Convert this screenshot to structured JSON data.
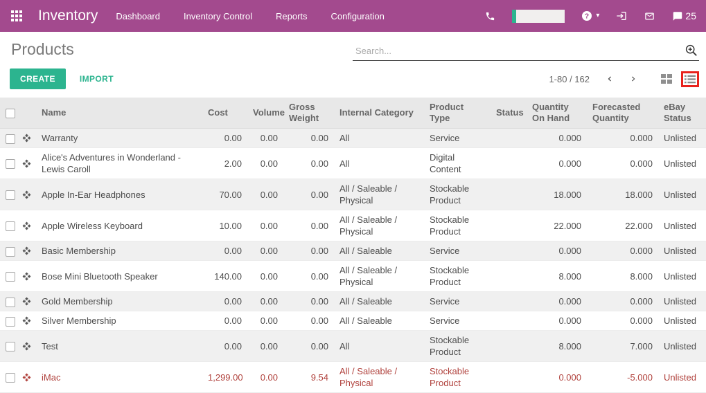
{
  "navbar": {
    "brand": "Inventory",
    "menu_items": [
      "Dashboard",
      "Inventory Control",
      "Reports",
      "Configuration"
    ],
    "message_count": "25",
    "icons": [
      "apps-grid-icon",
      "phone-icon",
      "planner-progress-bar",
      "help-circle-icon",
      "sign-in-icon",
      "envelope-icon",
      "chat-bubble-icon"
    ]
  },
  "control_panel": {
    "title": "Products",
    "search_placeholder": "Search...",
    "create_label": "CREATE",
    "import_label": "IMPORT",
    "pager_text": "1-80 / 162"
  },
  "table": {
    "columns": [
      {
        "label": "Name",
        "align": "left"
      },
      {
        "label": "Cost",
        "align": "right"
      },
      {
        "label": "Volume",
        "align": "right"
      },
      {
        "label": "Gross Weight",
        "align": "right"
      },
      {
        "label": "Internal Category",
        "align": "left"
      },
      {
        "label": "Product Type",
        "align": "left"
      },
      {
        "label": "Status",
        "align": "left"
      },
      {
        "label": "Quantity On Hand",
        "align": "right"
      },
      {
        "label": "Forecasted Quantity",
        "align": "right"
      },
      {
        "label": "eBay Status",
        "align": "left"
      }
    ],
    "rows": [
      {
        "cells": [
          "Warranty",
          "0.00",
          "0.00",
          "0.00",
          "All",
          "Service",
          "",
          "0.000",
          "0.000",
          "Unlisted"
        ],
        "alert": false
      },
      {
        "cells": [
          "Alice's Adventures in Wonderland - Lewis Caroll",
          "2.00",
          "0.00",
          "0.00",
          "All",
          "Digital Content",
          "",
          "0.000",
          "0.000",
          "Unlisted"
        ],
        "alert": false
      },
      {
        "cells": [
          "Apple In-Ear Headphones",
          "70.00",
          "0.00",
          "0.00",
          "All / Saleable / Physical",
          "Stockable Product",
          "",
          "18.000",
          "18.000",
          "Unlisted"
        ],
        "alert": false
      },
      {
        "cells": [
          "Apple Wireless Keyboard",
          "10.00",
          "0.00",
          "0.00",
          "All / Saleable / Physical",
          "Stockable Product",
          "",
          "22.000",
          "22.000",
          "Unlisted"
        ],
        "alert": false
      },
      {
        "cells": [
          "Basic Membership",
          "0.00",
          "0.00",
          "0.00",
          "All / Saleable",
          "Service",
          "",
          "0.000",
          "0.000",
          "Unlisted"
        ],
        "alert": false
      },
      {
        "cells": [
          "Bose Mini Bluetooth Speaker",
          "140.00",
          "0.00",
          "0.00",
          "All / Saleable / Physical",
          "Stockable Product",
          "",
          "8.000",
          "8.000",
          "Unlisted"
        ],
        "alert": false
      },
      {
        "cells": [
          "Gold Membership",
          "0.00",
          "0.00",
          "0.00",
          "All / Saleable",
          "Service",
          "",
          "0.000",
          "0.000",
          "Unlisted"
        ],
        "alert": false
      },
      {
        "cells": [
          "Silver Membership",
          "0.00",
          "0.00",
          "0.00",
          "All / Saleable",
          "Service",
          "",
          "0.000",
          "0.000",
          "Unlisted"
        ],
        "alert": false
      },
      {
        "cells": [
          "Test",
          "0.00",
          "0.00",
          "0.00",
          "All",
          "Stockable Product",
          "",
          "8.000",
          "7.000",
          "Unlisted"
        ],
        "alert": false
      },
      {
        "cells": [
          "iMac",
          "1,299.00",
          "0.00",
          "9.54",
          "All / Saleable / Physical",
          "Stockable Product",
          "",
          "0.000",
          "-5.000",
          "Unlisted"
        ],
        "alert": true
      }
    ]
  },
  "colors": {
    "navbar_bg": "#a34a8e",
    "accent_teal": "#2cb48f",
    "alert_red": "#b0413c",
    "annotation_red": "#e8231d",
    "header_bg": "#e8e8e8",
    "stripe_bg": "#f0f0f0"
  }
}
